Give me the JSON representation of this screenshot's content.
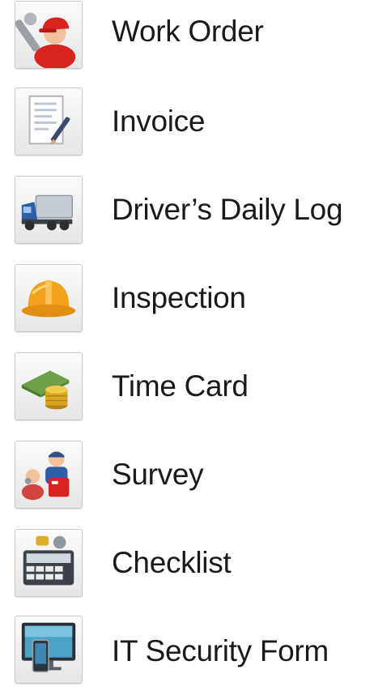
{
  "menu": {
    "items": [
      {
        "label": "Work Order",
        "icon": "mechanic-wrench-icon"
      },
      {
        "label": "Invoice",
        "icon": "document-pen-icon"
      },
      {
        "label": "Driver’s Daily Log",
        "icon": "truck-icon"
      },
      {
        "label": "Inspection",
        "icon": "hard-hat-icon"
      },
      {
        "label": "Time Card",
        "icon": "money-coins-icon"
      },
      {
        "label": "Survey",
        "icon": "people-survey-icon"
      },
      {
        "label": "Checklist",
        "icon": "device-checklist-icon"
      },
      {
        "label": "IT Security Form",
        "icon": "monitor-phone-icon"
      }
    ]
  },
  "colors": {
    "text": "#1a1a1a",
    "tile_top": "#fbfbfb",
    "tile_bottom": "#e6e6e6",
    "hat_orange": "#f3a21c",
    "cap_red": "#d9231f",
    "truck_blue": "#2c5fa8",
    "money_green": "#5f8f3c",
    "coin_gold": "#d9a623"
  }
}
